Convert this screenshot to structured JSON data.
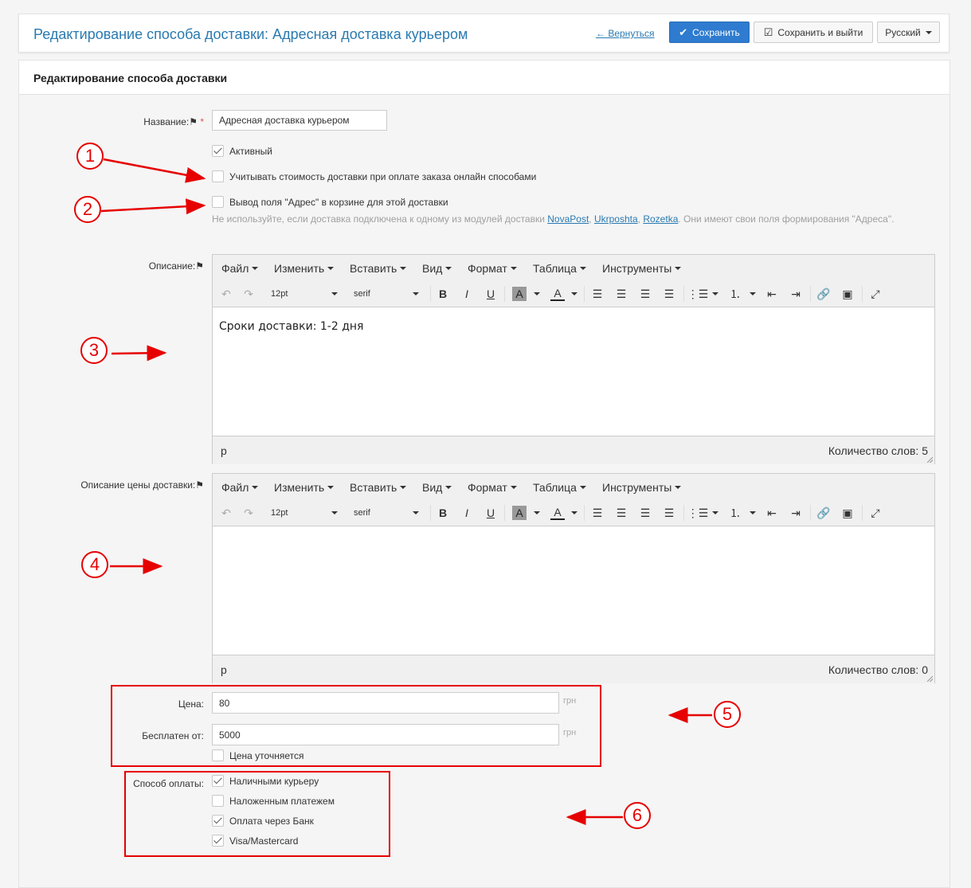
{
  "header": {
    "title": "Редактирование способа доставки: Адресная доставка курьером",
    "back_label": "← Вернуться",
    "save_label": "Сохранить",
    "save_exit_label": "Сохранить и выйти",
    "language": "Русский"
  },
  "panel": {
    "title": "Редактирование способа доставки"
  },
  "form": {
    "name_label": "Название:",
    "name_value": "Адресная доставка курьером",
    "active_label": "Активный",
    "active_checked": true,
    "online_cost_label": "Учитывать стоимость доставки при оплате заказа онлайн способами",
    "online_cost_checked": false,
    "address_field_label": "Вывод поля \"Адрес\" в корзине для этой доставки",
    "address_field_checked": false,
    "hint_prefix": "Не используйте, если доставка подключена к одному из модулей доставки ",
    "hint_links": [
      "NovaPost",
      "Ukrposhta",
      "Rozetka"
    ],
    "hint_suffix": ". Они имеют свои поля формирования \"Адреса\".",
    "description_label": "Описание:",
    "price_description_label": "Описание цены доставки:",
    "price_label": "Цена:",
    "price_value": "80",
    "currency": "грн",
    "free_from_label": "Бесплатен от:",
    "free_from_value": "5000",
    "price_clarify_label": "Цена уточняется",
    "price_clarify_checked": false,
    "payment_label": "Способ оплаты:",
    "payment_methods": [
      {
        "label": "Наличными курьеру",
        "checked": true
      },
      {
        "label": "Наложенным платежем",
        "checked": false
      },
      {
        "label": "Оплата через Банк",
        "checked": true
      },
      {
        "label": "Visa/Mastercard",
        "checked": true
      }
    ]
  },
  "editor": {
    "menus": [
      "Файл",
      "Изменить",
      "Вставить",
      "Вид",
      "Формат",
      "Таблица",
      "Инструменты"
    ],
    "font_size": "12pt",
    "font_family": "serif",
    "path_label": "p",
    "editor1_content": "Сроки доставки: 1-2 дня",
    "editor1_word_count": "Количество слов: 5",
    "editor2_content": "",
    "editor2_word_count": "Количество слов: 0"
  },
  "annotations": {
    "markers": [
      "1",
      "2",
      "3",
      "4",
      "5",
      "6"
    ],
    "color": "#e60000"
  },
  "colors": {
    "accent": "#2e7bcf",
    "link": "#2a7ab0",
    "required": "#d9534f"
  }
}
